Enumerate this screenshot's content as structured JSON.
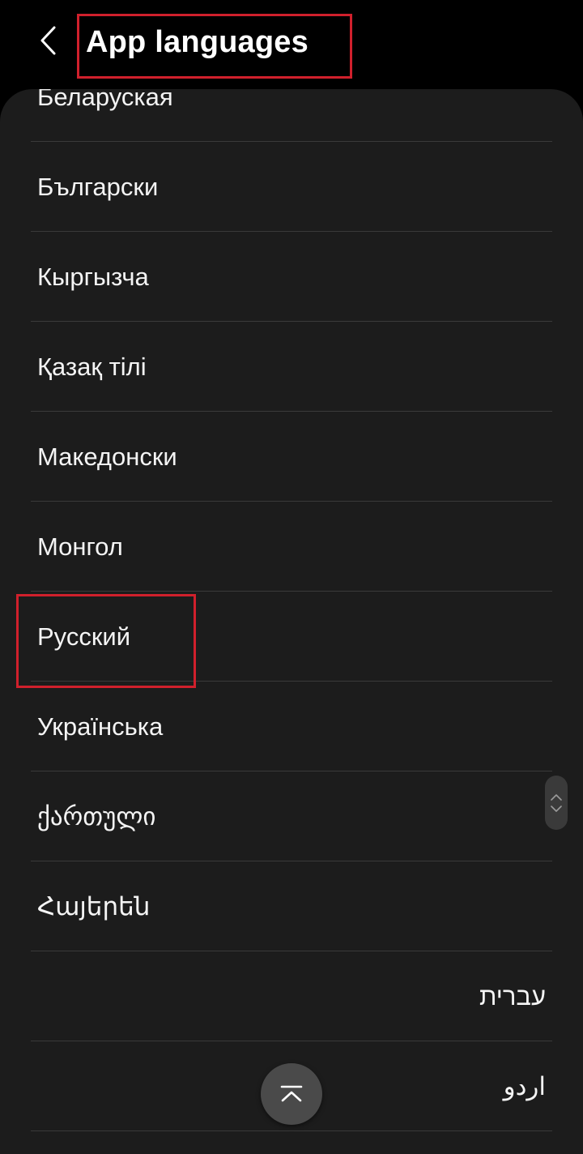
{
  "header": {
    "title": "App languages",
    "back_icon": "chevron-left-icon"
  },
  "languages": [
    {
      "label": "Беларуская",
      "rtl": false
    },
    {
      "label": "Български",
      "rtl": false
    },
    {
      "label": "Кыргызча",
      "rtl": false
    },
    {
      "label": "Қазақ тілі",
      "rtl": false
    },
    {
      "label": "Македонски",
      "rtl": false
    },
    {
      "label": "Монгол",
      "rtl": false
    },
    {
      "label": "Русский",
      "rtl": false
    },
    {
      "label": "Українська",
      "rtl": false
    },
    {
      "label": "ქართული",
      "rtl": false
    },
    {
      "label": "Հայերեն",
      "rtl": false
    },
    {
      "label": "עברית",
      "rtl": true
    },
    {
      "label": "اردو",
      "rtl": true
    }
  ],
  "scroll_top_icon": "chevron-up-bar-icon",
  "colors": {
    "background": "#000000",
    "card": "#1c1c1c",
    "divider": "#3a3a3a",
    "highlight": "#d0202c",
    "fab": "#4a4a4a"
  }
}
